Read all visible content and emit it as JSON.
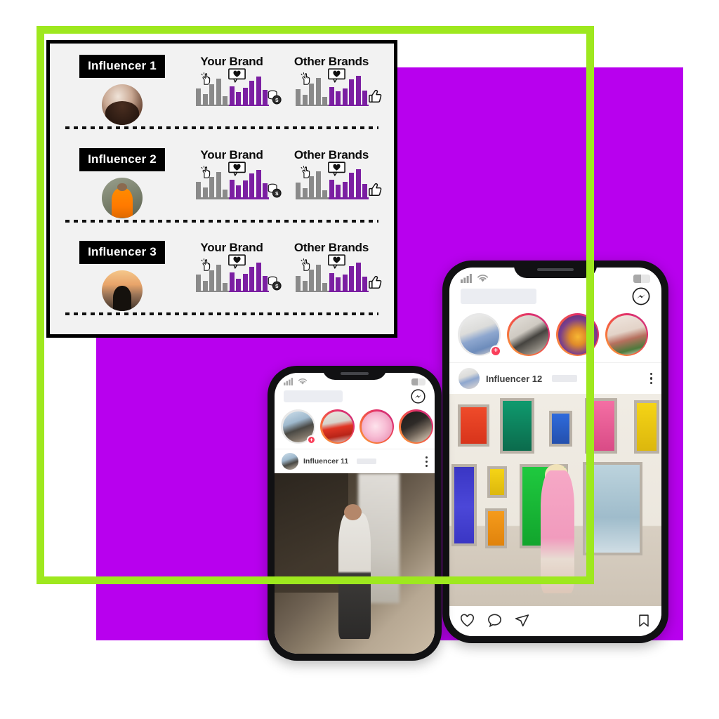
{
  "colors": {
    "purple_block": "#b800ee",
    "green_frame": "#9ee81e",
    "card_bg": "#f2f2f2",
    "bar_gray": "#8a8a8a",
    "bar_purple": "#7b1fa2",
    "badge_bg": "#000000",
    "story_ring": "#e1306c",
    "plus_badge": "#fa3e5a"
  },
  "card": {
    "name": "influencer-comparison-card",
    "rows": [
      {
        "badge_label": "Influencer 1",
        "avatar_name": "influencer-1-avatar",
        "your_brand": {
          "title": "Your Brand",
          "icons": [
            "tap-icon",
            "heart-bubble-icon",
            "coin-stack-icon"
          ],
          "gray_bars": [
            55,
            35,
            70,
            88,
            28
          ],
          "purple_bars": [
            62,
            42,
            58,
            82,
            95,
            50
          ]
        },
        "other_brands": {
          "title": "Other Brands",
          "icons": [
            "tap-icon",
            "heart-bubble-icon",
            "thumbs-up-icon"
          ],
          "gray_bars": [
            52,
            33,
            72,
            90,
            26
          ],
          "purple_bars": [
            60,
            45,
            55,
            85,
            97,
            48
          ]
        }
      },
      {
        "badge_label": "Influencer 2",
        "avatar_name": "influencer-2-avatar",
        "your_brand": {
          "title": "Your Brand",
          "icons": [
            "tap-icon",
            "heart-bubble-icon",
            "coin-stack-icon"
          ],
          "gray_bars": [
            55,
            35,
            70,
            88,
            28
          ],
          "purple_bars": [
            62,
            42,
            58,
            82,
            95,
            50
          ]
        },
        "other_brands": {
          "title": "Other Brands",
          "icons": [
            "tap-icon",
            "heart-bubble-icon",
            "thumbs-up-icon"
          ],
          "gray_bars": [
            52,
            33,
            72,
            90,
            26
          ],
          "purple_bars": [
            60,
            45,
            55,
            85,
            97,
            48
          ]
        }
      },
      {
        "badge_label": "Influencer 3",
        "avatar_name": "influencer-3-avatar",
        "your_brand": {
          "title": "Your Brand",
          "icons": [
            "tap-icon",
            "heart-bubble-icon",
            "coin-stack-icon"
          ],
          "gray_bars": [
            55,
            35,
            70,
            88,
            28
          ],
          "purple_bars": [
            62,
            42,
            58,
            82,
            95,
            50
          ]
        },
        "other_brands": {
          "title": "Other Brands",
          "icons": [
            "tap-icon",
            "heart-bubble-icon",
            "thumbs-up-icon"
          ],
          "gray_bars": [
            52,
            33,
            72,
            90,
            26
          ],
          "purple_bars": [
            60,
            45,
            55,
            85,
            97,
            48
          ]
        }
      }
    ]
  },
  "phone_back": {
    "name": "instagram-phone-back",
    "statusbar": {
      "signal_icon": "cellular-signal-icon",
      "wifi_icon": "wifi-icon",
      "battery_icon": "battery-icon",
      "battery_level": 44
    },
    "header": {
      "logo_placeholder": "redacted-logo-bar",
      "messenger_icon": "messenger-icon"
    },
    "stories": [
      {
        "name": "your-story",
        "has_plus": true,
        "plus_label": "+",
        "ring": "plain"
      },
      {
        "name": "story-2",
        "has_plus": false,
        "ring": "gradient"
      },
      {
        "name": "story-3",
        "has_plus": false,
        "ring": "gradient"
      },
      {
        "name": "story-4",
        "has_plus": false,
        "ring": "gradient"
      }
    ],
    "post": {
      "author": "Influencer 12",
      "redacted_handle": "redacted-handle-bar",
      "menu_icon": "kebab-menu-icon",
      "photo_name": "post-photo-gallery-wall",
      "actions": [
        {
          "name": "like-icon",
          "label": "heart"
        },
        {
          "name": "comment-icon",
          "label": "comment"
        },
        {
          "name": "share-icon",
          "label": "paper-plane"
        },
        {
          "name": "bookmark-icon",
          "label": "bookmark"
        }
      ]
    }
  },
  "phone_front": {
    "name": "instagram-phone-front",
    "statusbar": {
      "signal_icon": "cellular-signal-icon",
      "wifi_icon": "wifi-icon",
      "battery_icon": "battery-icon",
      "battery_level": 44
    },
    "header": {
      "logo_placeholder": "redacted-logo-bar",
      "messenger_icon": "messenger-icon"
    },
    "stories": [
      {
        "name": "your-story",
        "has_plus": true,
        "plus_label": "+",
        "ring": "plain"
      },
      {
        "name": "story-2",
        "has_plus": false,
        "ring": "gradient"
      },
      {
        "name": "story-3",
        "has_plus": false,
        "ring": "gradient"
      },
      {
        "name": "story-4",
        "has_plus": false,
        "ring": "gradient"
      }
    ],
    "post": {
      "author": "Influencer 11",
      "redacted_handle": "redacted-handle-bar",
      "menu_icon": "kebab-menu-icon",
      "photo_name": "post-photo-waterfall"
    }
  }
}
